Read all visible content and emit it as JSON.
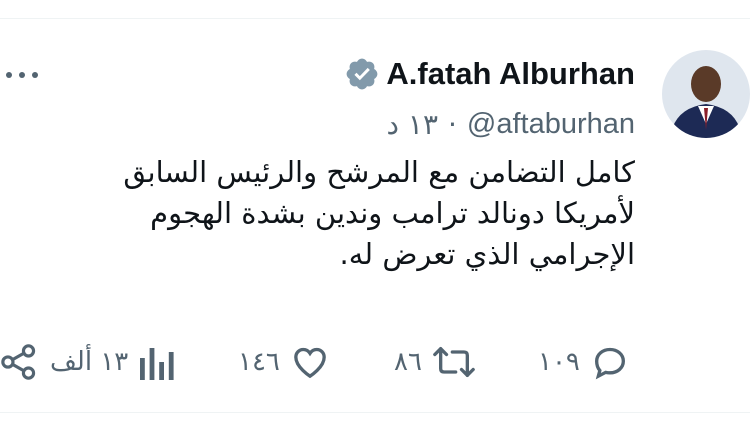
{
  "tweet": {
    "author_name": "A.fatah Alburhan",
    "handle": "@aftaburhan",
    "separator": "·",
    "time": "١٣ د",
    "lines": [
      "كامل التضامن مع المرشح والرئيس السابق",
      "لأمريكا دونالد ترامب وندين بشدة الهجوم",
      "الإجرامي الذي تعرض له."
    ]
  },
  "actions": {
    "replies": "١٠٩",
    "retweets": "٨٦",
    "likes": "١٤٦",
    "views": "١٣ ألف"
  },
  "colors": {
    "text": "#0f1419",
    "muted": "#536471",
    "verified": "#829aab"
  },
  "icons": [
    "more-icon",
    "verified-icon",
    "reply-icon",
    "retweet-icon",
    "like-icon",
    "views-icon",
    "share-icon"
  ]
}
